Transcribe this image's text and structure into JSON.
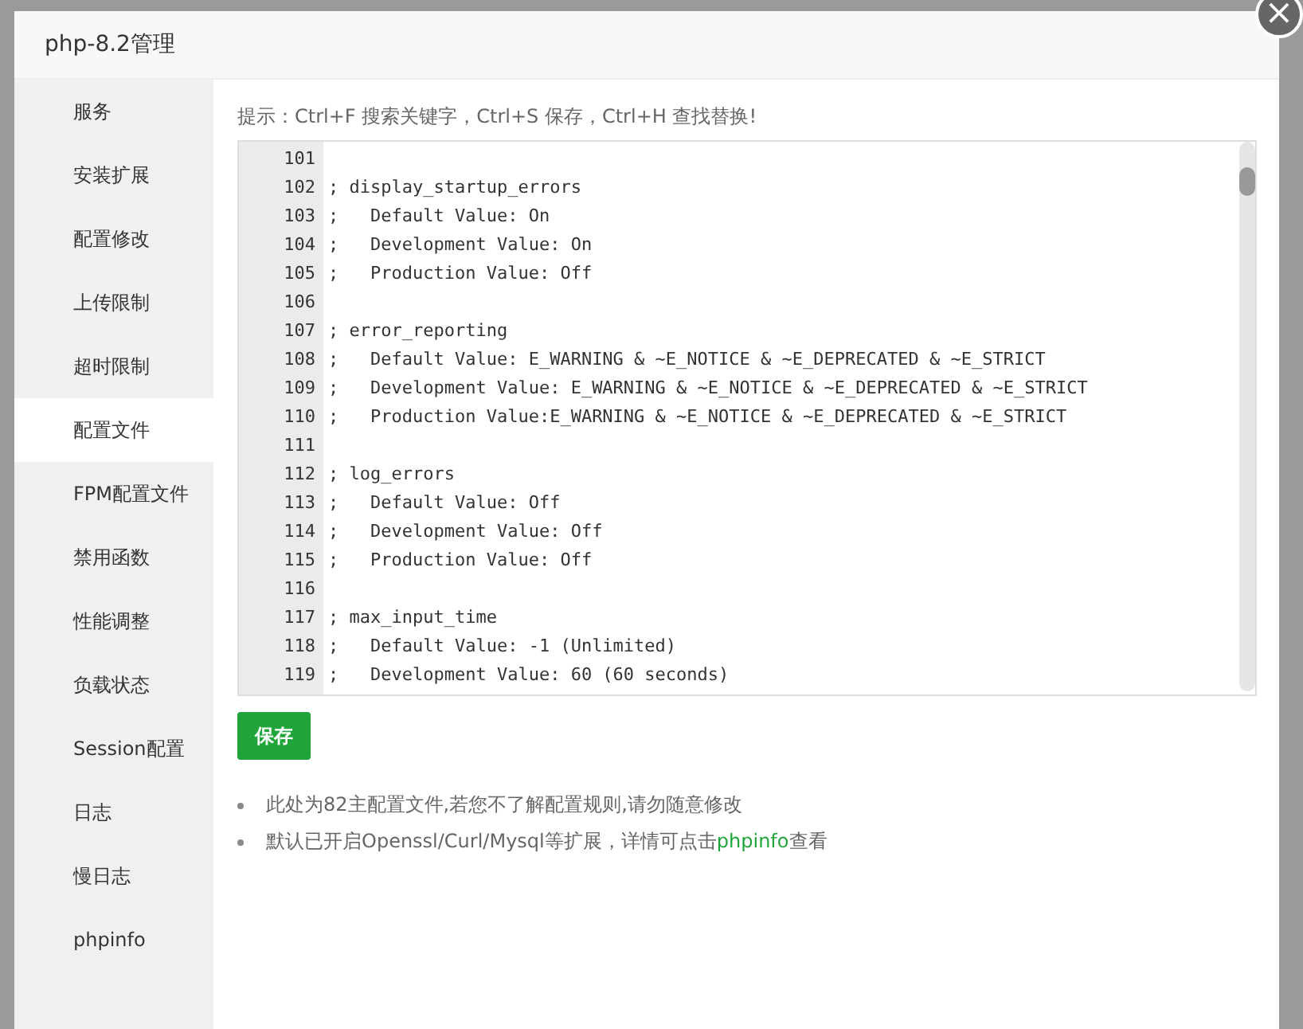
{
  "dialog": {
    "title": "php-8.2管理",
    "close_icon": "×"
  },
  "sidebar": {
    "items": [
      {
        "label": "服务",
        "selected": false
      },
      {
        "label": "安装扩展",
        "selected": false
      },
      {
        "label": "配置修改",
        "selected": false
      },
      {
        "label": "上传限制",
        "selected": false
      },
      {
        "label": "超时限制",
        "selected": false
      },
      {
        "label": "配置文件",
        "selected": true
      },
      {
        "label": "FPM配置文件",
        "selected": false
      },
      {
        "label": "禁用函数",
        "selected": false
      },
      {
        "label": "性能调整",
        "selected": false
      },
      {
        "label": "负载状态",
        "selected": false
      },
      {
        "label": "Session配置",
        "selected": false
      },
      {
        "label": "日志",
        "selected": false
      },
      {
        "label": "慢日志",
        "selected": false
      },
      {
        "label": "phpinfo",
        "selected": false
      }
    ]
  },
  "hint": "提示：Ctrl+F 搜索关键字，Ctrl+S 保存，Ctrl+H 查找替换!",
  "editor": {
    "lines": [
      {
        "number": "101"
      },
      {
        "number": "102",
        "text": "; display_startup_errors"
      },
      {
        "number": "103",
        "text": ";   Default Value: On"
      },
      {
        "number": "104",
        "text": ";   Development Value: On"
      },
      {
        "number": "105",
        "text": ";   Production Value: Off"
      },
      {
        "number": "106"
      },
      {
        "number": "107",
        "text": "; error_reporting"
      },
      {
        "number": "108",
        "text": ";   Default Value: E_WARNING & ~E_NOTICE & ~E_DEPRECATED & ~E_STRICT"
      },
      {
        "number": "109",
        "text": ";   Development Value: E_WARNING & ~E_NOTICE & ~E_DEPRECATED & ~E_STRICT"
      },
      {
        "number": "110",
        "text": ";   Production Value:E_WARNING & ~E_NOTICE & ~E_DEPRECATED & ~E_STRICT"
      },
      {
        "number": "111"
      },
      {
        "number": "112",
        "text": "; log_errors"
      },
      {
        "number": "113",
        "text": ";   Default Value: Off"
      },
      {
        "number": "114",
        "text": ";   Development Value: Off"
      },
      {
        "number": "115",
        "text": ";   Production Value: Off"
      },
      {
        "number": "116"
      },
      {
        "number": "117",
        "text": "; max_input_time"
      },
      {
        "number": "118",
        "text": ";   Default Value: -1 (Unlimited)"
      },
      {
        "number": "119",
        "text": ";   Development Value: 60 (60 seconds)"
      }
    ]
  },
  "save_button": "保存",
  "notes": [
    {
      "text": "此处为82主配置文件,若您不了解配置规则,请勿随意修改"
    },
    {
      "text": "默认已开启Openssl/Curl/Mysql等扩展，详情可点击",
      "link": "phpinfo",
      "after": "查看"
    }
  ]
}
